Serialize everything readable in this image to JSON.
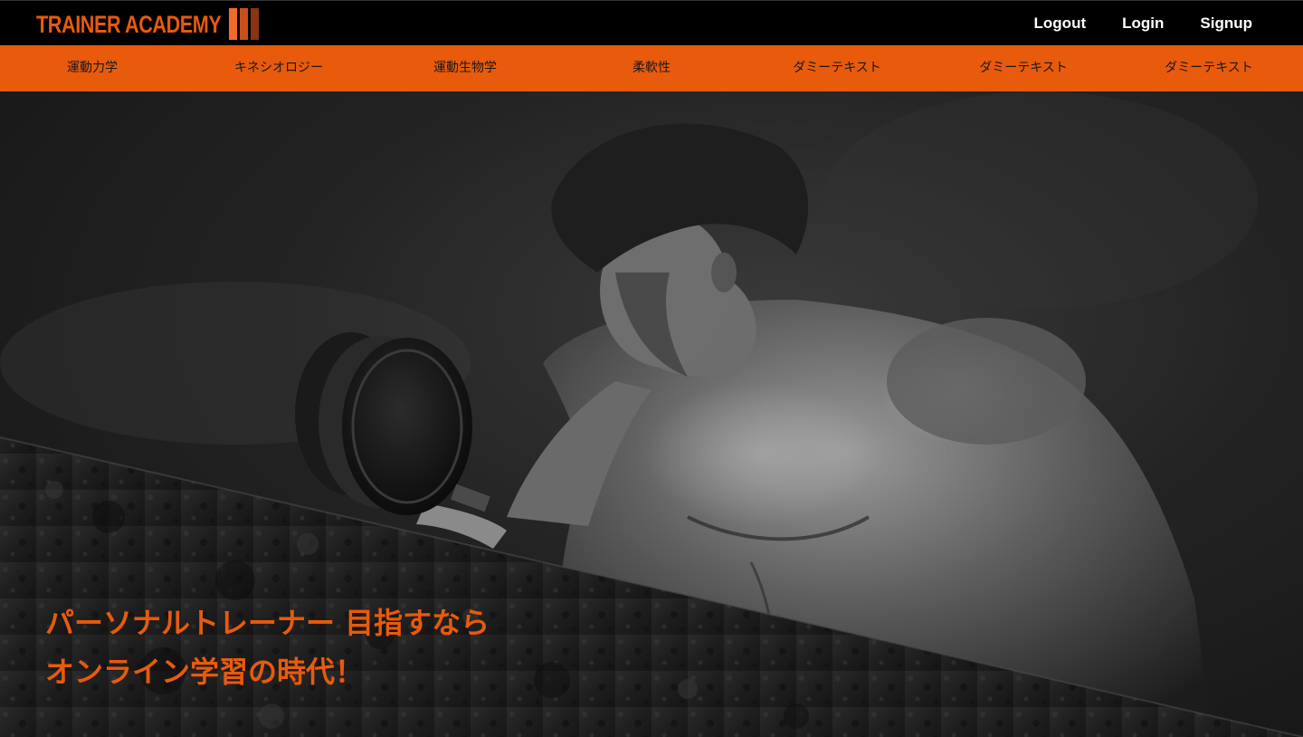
{
  "theme": {
    "accent": "#e85a0c",
    "header_bg": "#000000",
    "text_on_dark": "#ffffff"
  },
  "header": {
    "logo_text": "TRAINER ACADEMY",
    "auth": {
      "logout": "Logout",
      "login": "Login",
      "signup": "Signup"
    }
  },
  "categories": [
    "運動力学",
    "キネシオロジー",
    "運動生物学",
    "柔軟性",
    "ダミーテキスト",
    "ダミーテキスト",
    "ダミーテキスト"
  ],
  "hero": {
    "image": "bodybuilder-dumbbell-curl-photo",
    "headline_line1": "パーソナルトレーナー 目指すなら",
    "headline_line2": "オンライン学習の時代！"
  }
}
